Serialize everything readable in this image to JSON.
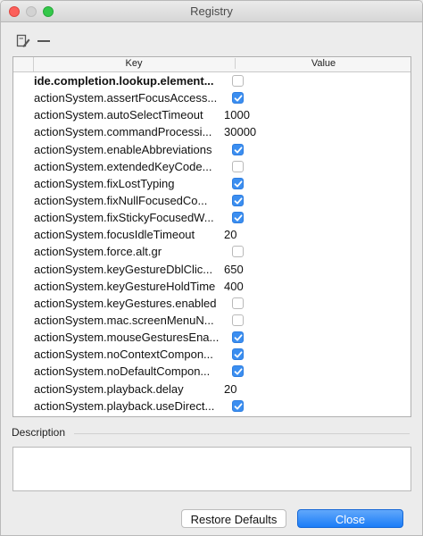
{
  "window": {
    "title": "Registry"
  },
  "table": {
    "headers": {
      "key": "Key",
      "value": "Value"
    },
    "rows": [
      {
        "key": "ide.completion.lookup.element...",
        "type": "check",
        "checked": false,
        "bold": true
      },
      {
        "key": "actionSystem.assertFocusAccess...",
        "type": "check",
        "checked": true
      },
      {
        "key": "actionSystem.autoSelectTimeout",
        "type": "text",
        "value": "1000"
      },
      {
        "key": "actionSystem.commandProcessi...",
        "type": "text",
        "value": "30000"
      },
      {
        "key": "actionSystem.enableAbbreviations",
        "type": "check",
        "checked": true
      },
      {
        "key": "actionSystem.extendedKeyCode...",
        "type": "check",
        "checked": false
      },
      {
        "key": "actionSystem.fixLostTyping",
        "type": "check",
        "checked": true
      },
      {
        "key": "actionSystem.fixNullFocusedCo...",
        "type": "check",
        "checked": true
      },
      {
        "key": "actionSystem.fixStickyFocusedW...",
        "type": "check",
        "checked": true
      },
      {
        "key": "actionSystem.focusIdleTimeout",
        "type": "text",
        "value": "20"
      },
      {
        "key": "actionSystem.force.alt.gr",
        "type": "check",
        "checked": false
      },
      {
        "key": "actionSystem.keyGestureDblClic...",
        "type": "text",
        "value": "650"
      },
      {
        "key": "actionSystem.keyGestureHoldTime",
        "type": "text",
        "value": "400"
      },
      {
        "key": "actionSystem.keyGestures.enabled",
        "type": "check",
        "checked": false
      },
      {
        "key": "actionSystem.mac.screenMenuN...",
        "type": "check",
        "checked": false
      },
      {
        "key": "actionSystem.mouseGesturesEna...",
        "type": "check",
        "checked": true
      },
      {
        "key": "actionSystem.noContextCompon...",
        "type": "check",
        "checked": true
      },
      {
        "key": "actionSystem.noDefaultCompon...",
        "type": "check",
        "checked": true
      },
      {
        "key": "actionSystem.playback.delay",
        "type": "text",
        "value": "20"
      },
      {
        "key": "actionSystem.playback.useDirect...",
        "type": "check",
        "checked": true
      }
    ]
  },
  "description": {
    "label": "Description",
    "text": ""
  },
  "buttons": {
    "restore_defaults": "Restore Defaults",
    "close": "Close"
  },
  "colors": {
    "accent": "#3b8ef0",
    "close_button": "#1a7cf7"
  },
  "icons": {
    "edit": "edit-icon",
    "remove": "minus-icon"
  }
}
